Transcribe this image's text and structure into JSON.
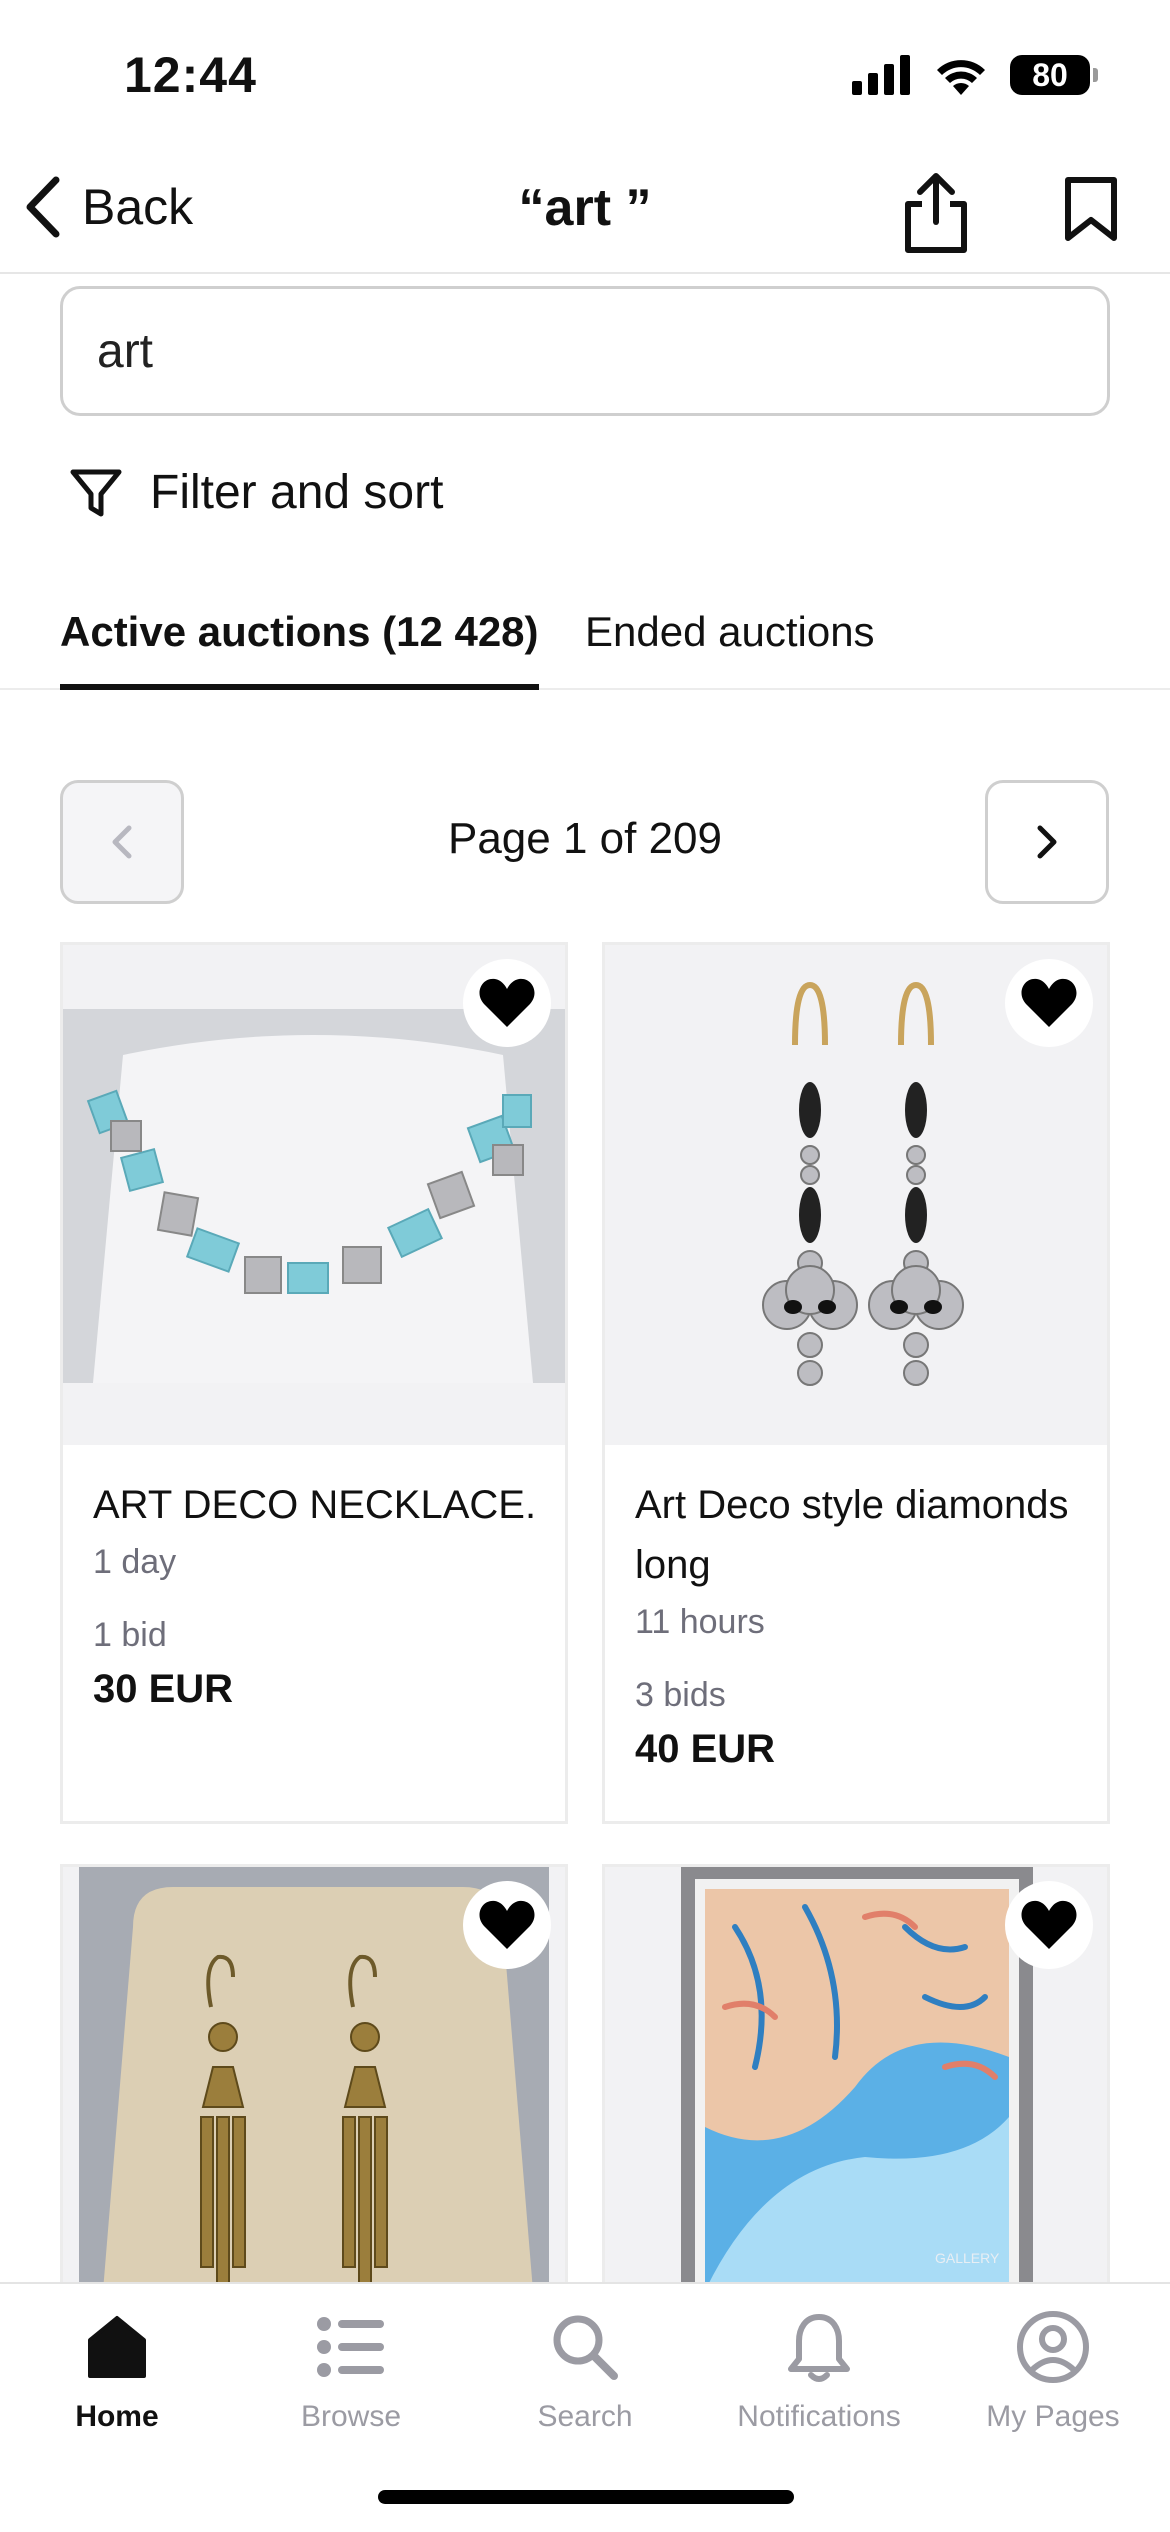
{
  "status_bar": {
    "time": "12:44",
    "battery": "80"
  },
  "nav": {
    "back_label": "Back",
    "title": "“art ”"
  },
  "search": {
    "value": "art"
  },
  "filter": {
    "label": "Filter and sort"
  },
  "tabs": [
    {
      "label": "Active auctions (12 428)",
      "active": true
    },
    {
      "label": "Ended auctions",
      "active": false
    }
  ],
  "pagination": {
    "text": "Page 1 of 209"
  },
  "listings": [
    {
      "title": "ART DECO NECKLACE.",
      "time_left": "1 day",
      "bids": "1 bid",
      "price": "30 EUR"
    },
    {
      "title": "Art Deco style diamonds long",
      "time_left": "11 hours",
      "bids": "3 bids",
      "price": "40 EUR"
    },
    {
      "title": "",
      "time_left": "",
      "bids": "",
      "price": ""
    },
    {
      "title": "",
      "time_left": "",
      "bids": "",
      "price": "",
      "image_text": "GALLERY"
    }
  ],
  "tabbar": [
    {
      "label": "Home",
      "icon": "home-icon",
      "active": true
    },
    {
      "label": "Browse",
      "icon": "list-icon",
      "active": false
    },
    {
      "label": "Search",
      "icon": "search-icon",
      "active": false
    },
    {
      "label": "Notifications",
      "icon": "bell-icon",
      "active": false
    },
    {
      "label": "My Pages",
      "icon": "user-circle-icon",
      "active": false
    }
  ],
  "colors": {
    "accent": "#111111",
    "muted": "#6e6e7a",
    "tab_inactive": "#9b9ba3"
  }
}
